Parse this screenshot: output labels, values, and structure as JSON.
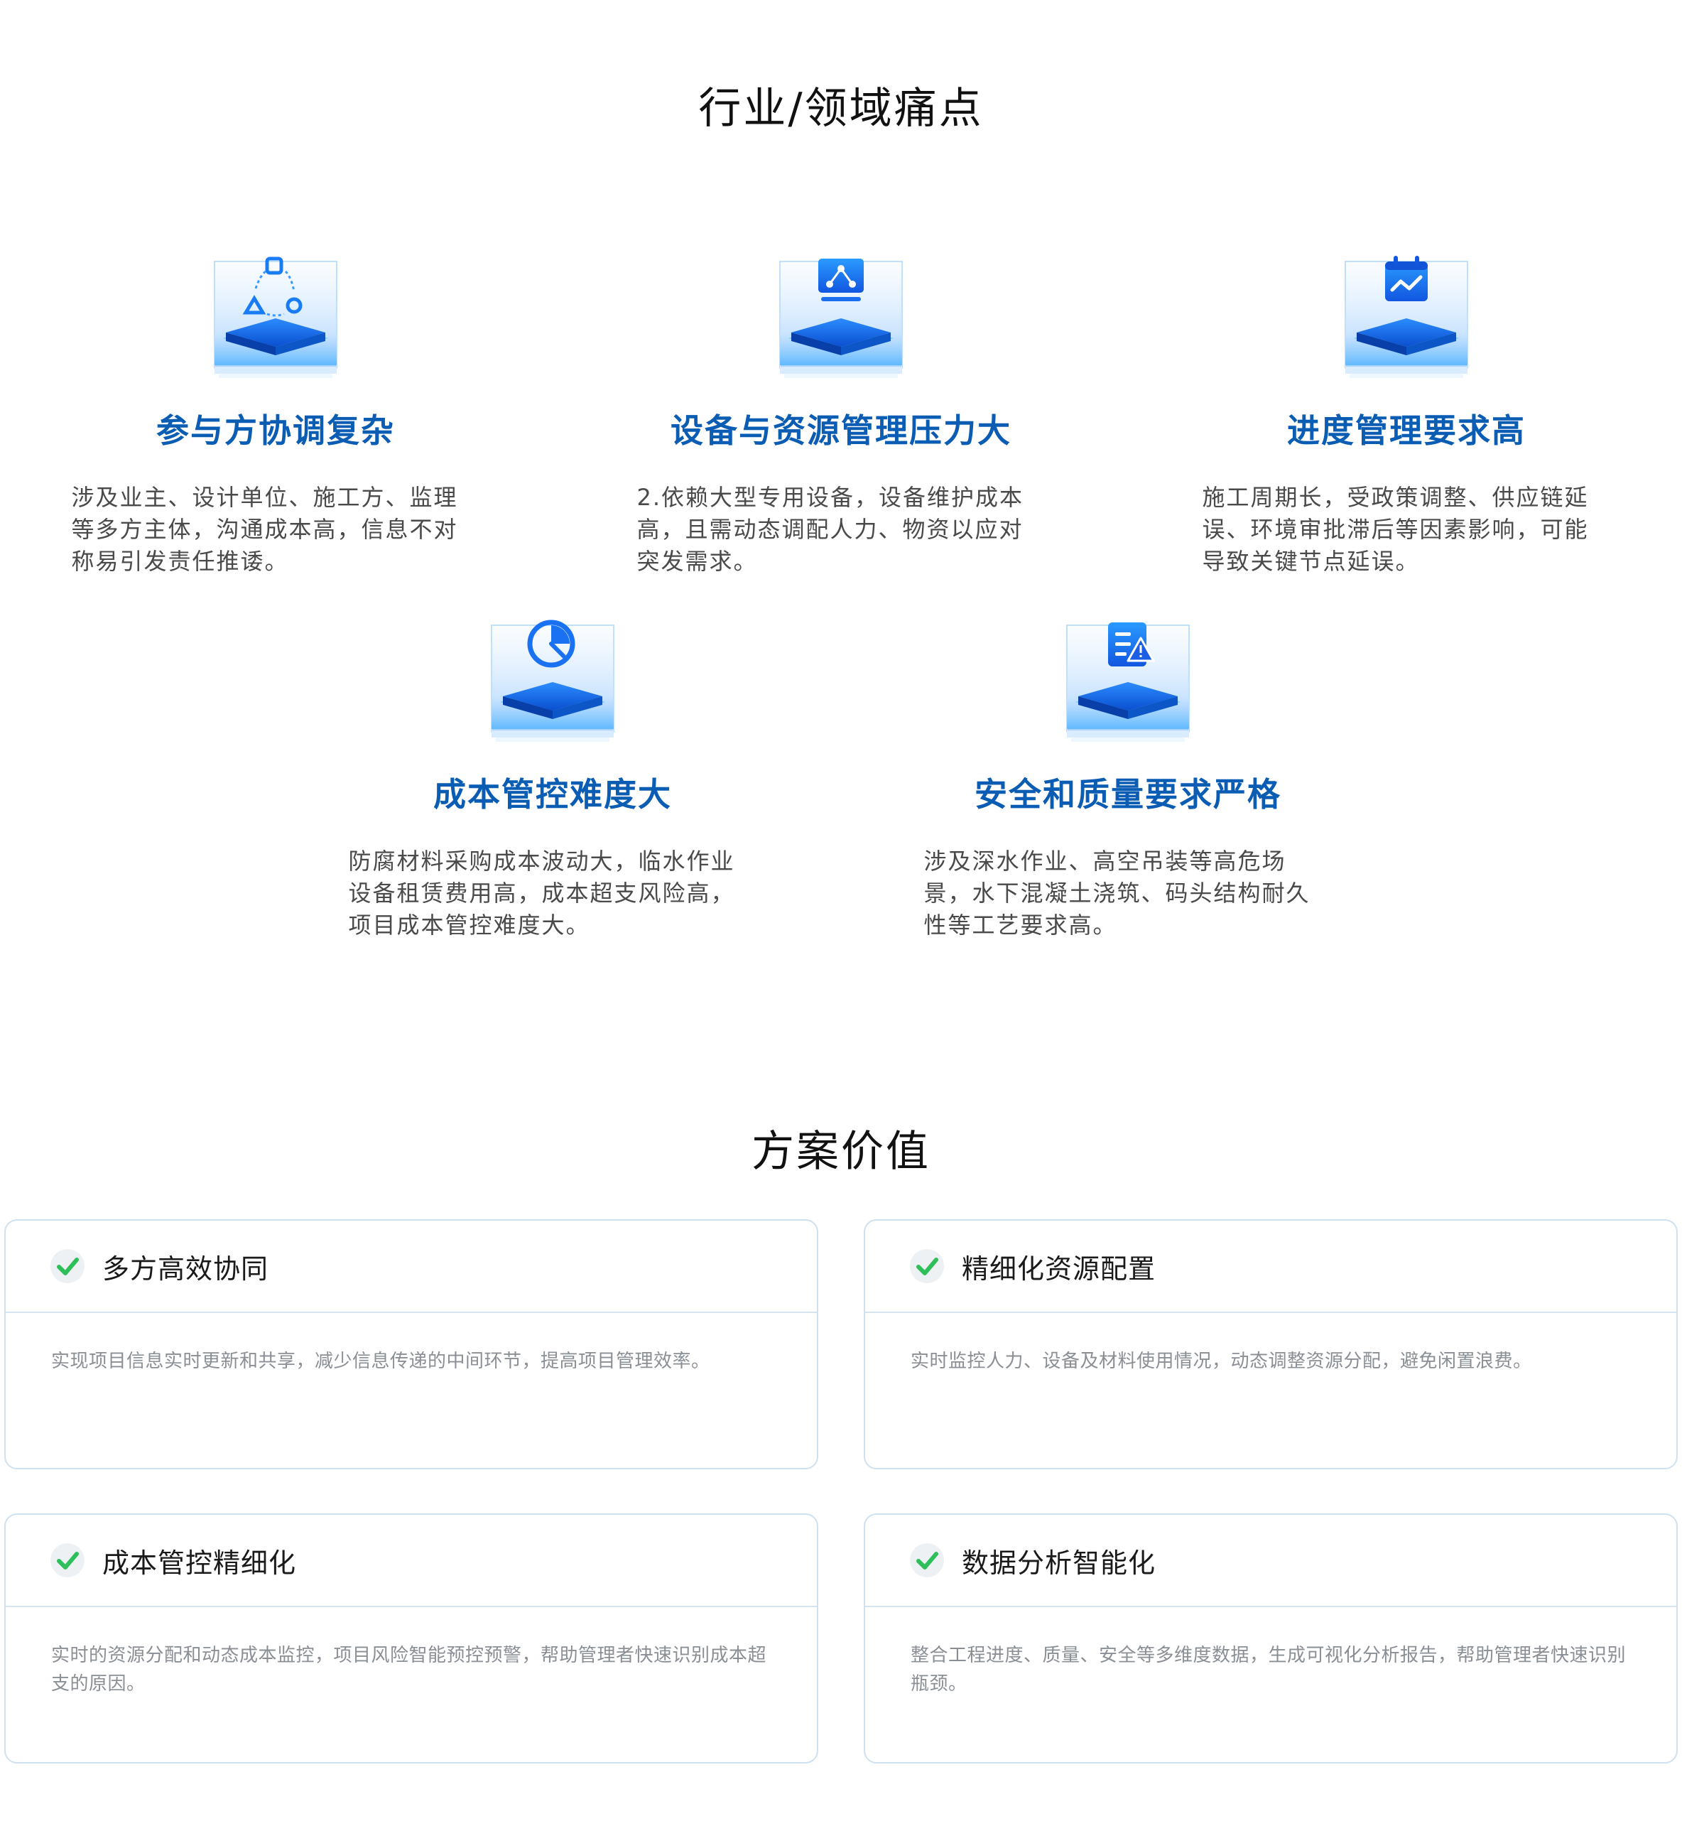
{
  "section1": {
    "title": "行业/领域痛点"
  },
  "pain_points": [
    {
      "title": "参与方协调复杂",
      "desc": "涉及业主、设计单位、施工方、监理等多方主体，沟通成本高，信息不对称易引发责任推诿。",
      "icon": "shapes-icon"
    },
    {
      "title": "设备与资源管理压力大",
      "desc": "2.依赖大型专用设备，设备维护成本高，且需动态调配人力、物资以应对突发需求。",
      "icon": "network-monitor-icon"
    },
    {
      "title": "进度管理要求高",
      "desc": "施工周期长，受政策调整、供应链延误、环境审批滞后等因素影响，可能导致关键节点延误。",
      "icon": "calendar-chart-icon"
    },
    {
      "title": "成本管控难度大",
      "desc": "防腐材料采购成本波动大，临水作业设备租赁费用高，成本超支风险高，项目成本管控难度大。",
      "icon": "pie-chart-icon"
    },
    {
      "title": "安全和质量要求严格",
      "desc": "涉及深水作业、高空吊装等高危场景，水下混凝土浇筑、码头结构耐久性等工艺要求高。",
      "icon": "warning-document-icon"
    }
  ],
  "section2": {
    "title": "方案价值"
  },
  "values": [
    {
      "title": "多方高效协同",
      "desc": "实现项目信息实时更新和共享，减少信息传递的中间环节，提高项目管理效率。"
    },
    {
      "title": "精细化资源配置",
      "desc": "实时监控人力、设备及材料使用情况，动态调整资源分配，避免闲置浪费。"
    },
    {
      "title": "成本管控精细化",
      "desc": "实时的资源分配和动态成本监控，项目风险智能预控预警，帮助管理者快速识别成本超支的原因。"
    },
    {
      "title": "数据分析智能化",
      "desc": "整合工程进度、质量、安全等多维度数据，生成可视化分析报告，帮助管理者快速识别瓶颈。"
    }
  ],
  "colors": {
    "accent": "#0b5db3",
    "check": "#2fbf5a",
    "border": "#cfe0f1"
  }
}
